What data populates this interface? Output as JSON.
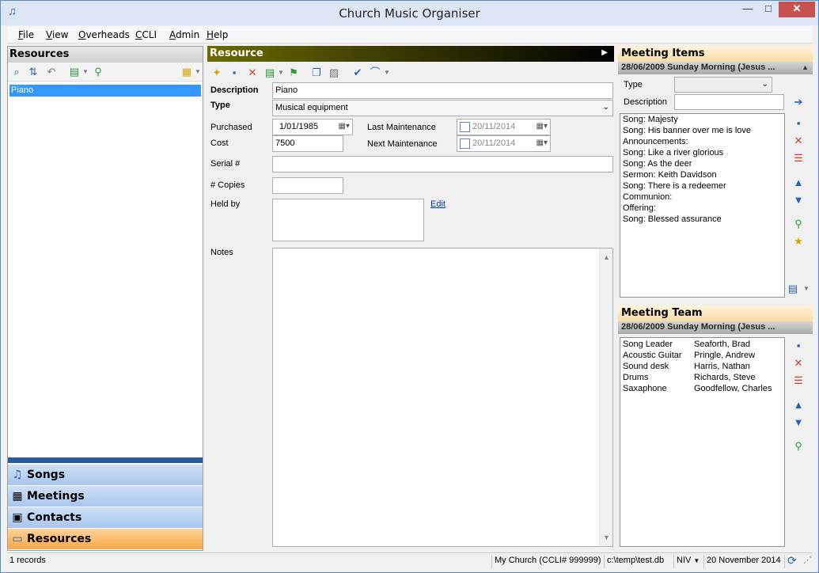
{
  "window": {
    "title": "Church Music Organiser",
    "minimize": "—",
    "maximize": "□",
    "close": "✕"
  },
  "menu": [
    "File",
    "View",
    "Overheads",
    "CCLI",
    "Admin",
    "Help"
  ],
  "left": {
    "title": "Resources",
    "items": [
      "Piano"
    ],
    "nav": [
      {
        "label": "Songs",
        "icon": "music-note-icon"
      },
      {
        "label": "Meetings",
        "icon": "calendar-icon"
      },
      {
        "label": "Contacts",
        "icon": "contact-card-icon"
      },
      {
        "label": "Resources",
        "icon": "monitor-icon"
      }
    ]
  },
  "resource": {
    "header": "Resource",
    "description_label": "Description",
    "description_value": "Piano",
    "type_label": "Type",
    "type_value": "Musical equipment",
    "purchased_label": "Purchased",
    "purchased_value": "1/01/1985",
    "cost_label": "Cost",
    "cost_value": "7500",
    "last_maintenance_label": "Last Maintenance",
    "last_maintenance_value": "20/11/2014",
    "next_maintenance_label": "Next Maintenance",
    "next_maintenance_value": "20/11/2014",
    "serial_label": "Serial #",
    "serial_value": "",
    "copies_label": "# Copies",
    "copies_value": "",
    "heldby_label": "Held by",
    "heldby_value": "",
    "edit_link": "Edit",
    "notes_label": "Notes",
    "notes_value": ""
  },
  "meeting_items": {
    "title": "Meeting Items",
    "meeting": "28/06/2009 Sunday Morning (Jesus ...",
    "type_label": "Type",
    "type_value": "",
    "description_label": "Description",
    "description_value": "",
    "items": [
      "Song: Majesty",
      "Song: His banner over me is love",
      "Announcements:",
      "Song: Like a river glorious",
      "Song: As the deer",
      "Sermon: Keith Davidson",
      "Song: There is a redeemer",
      "Communion:",
      "Offering:",
      "Song: Blessed assurance"
    ]
  },
  "meeting_team": {
    "title": "Meeting Team",
    "meeting": "28/06/2009 Sunday Morning (Jesus ...",
    "members": [
      {
        "role": "Song Leader",
        "person": "Seaforth, Brad"
      },
      {
        "role": "Acoustic Guitar",
        "person": "Pringle, Andrew"
      },
      {
        "role": "Sound desk",
        "person": "Harris, Nathan"
      },
      {
        "role": "Drums",
        "person": "Richards, Steve"
      },
      {
        "role": "Saxaphone",
        "person": "Goodfellow, Charles"
      }
    ]
  },
  "status": {
    "records": "1 records",
    "church": "My Church (CCLI# 999999)",
    "db": "c:\\temp\\test.db",
    "bible": "NIV",
    "date": "20 November 2014"
  },
  "colors": {
    "accent": "#3399ff",
    "nav_active": "#f7a747",
    "nav": "#a8c6ee",
    "resource_header": "#6b6b00"
  }
}
